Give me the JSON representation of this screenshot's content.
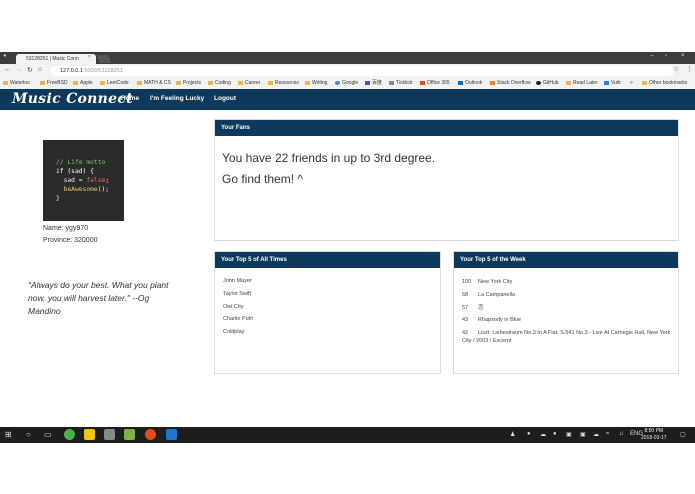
{
  "browser": {
    "tab_title": "53128251 | Music Conn",
    "tab_close": "×",
    "window_controls": [
      "–",
      "▫",
      "×"
    ],
    "url_host": "127.0.0.1",
    "url_rest": ":5000/53128251",
    "bookmarks": [
      "Waterloo",
      "FreeBSD",
      "Apple",
      "LeetCode",
      "MATH & CS",
      "Projects",
      "Coding",
      "Career",
      "Resources",
      "Writing",
      "Google",
      "百度",
      "Ticktick",
      "Office 365",
      "Outlook",
      "Stack Overflow",
      "GitHub",
      "Read Later",
      "Vultr",
      "»",
      "Other bookmarks"
    ]
  },
  "nav": {
    "brand": "Music Connect",
    "links": [
      "Home",
      "I'm Feeling Lucky",
      "Logout"
    ]
  },
  "profile": {
    "code_lines": {
      "l1": "// Life motto",
      "l2a": "if (sad) {",
      "l3a": "  sad = ",
      "l3b": "false",
      "l3c": ";",
      "l4a": "  beAwesome",
      "l4b": "();",
      "l5": "}"
    },
    "name": "Name: ygy970",
    "province": "Province: 320000",
    "quote": "\"Always do your best. What you plant now, you will harvest later.\" --Og Mandino"
  },
  "fans": {
    "header": "Your Fans",
    "line1": "You have 22 friends in up to 3rd degree.",
    "line2": "Go find them! ^"
  },
  "top_all_time": {
    "header": "Your Top 5 of All Times",
    "items": [
      "John Mayer",
      "Taylor Swift",
      "Owl City",
      "Charlie Puth",
      "Coldplay"
    ]
  },
  "top_week": {
    "header": "Your Top 5 of the Week",
    "items": [
      {
        "count": "100",
        "title": "New York City"
      },
      {
        "count": "68",
        "title": "La Campanella"
      },
      {
        "count": "57",
        "title": "恋"
      },
      {
        "count": "43",
        "title": "Rhapsody in Blue"
      },
      {
        "count": "42",
        "title": "Liszt: Liebestraum No.3 In A Flat, S.541 No.3 - Live At Carnegie Hall, New York City / 2003 / Excerpt"
      }
    ]
  },
  "taskbar": {
    "time": "8:50 PM",
    "date": "2018-03-17",
    "lang": "ENG"
  },
  "colors": {
    "navbar": "#0d3a5c",
    "panel_header": "#0d3a5c"
  }
}
